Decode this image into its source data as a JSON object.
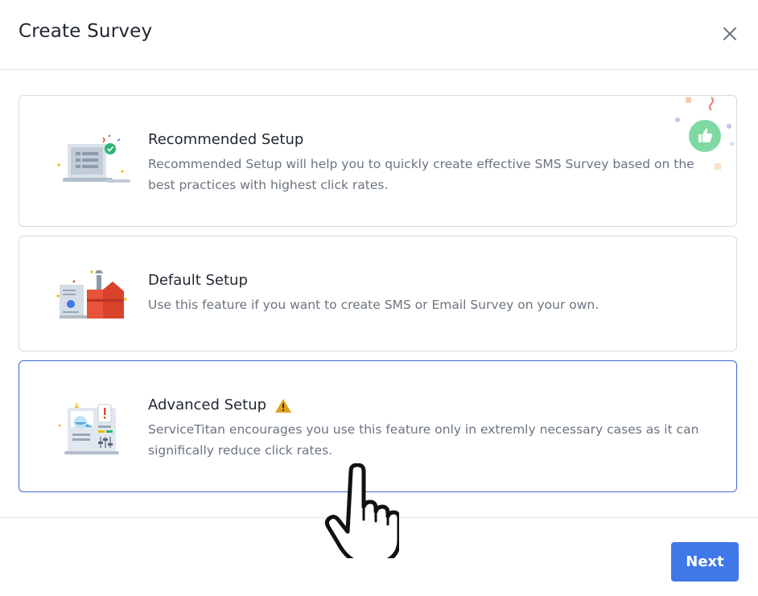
{
  "dialog": {
    "title": "Create Survey",
    "close_icon": "close-icon"
  },
  "options": [
    {
      "title": "Recommended Setup",
      "description": "Recommended Setup will help you to quickly create effective SMS Survey based on the best practices with highest click rates.",
      "illustration": "laptop-checklist-illustration",
      "badge_icon": "thumbs-up-icon"
    },
    {
      "title": "Default Setup",
      "description": "Use this feature if you want to create SMS or Email Survey on your own.",
      "illustration": "toolbox-illustration"
    },
    {
      "title": "Advanced Setup",
      "description": "ServiceTitan encourages you use this feature only in extremly necessary cases as it can significally reduce click rates.",
      "illustration": "control-panel-illustration",
      "warning_icon": "warning-icon",
      "selected": true
    }
  ],
  "footer": {
    "next_label": "Next"
  },
  "colors": {
    "accent": "#3f78e8",
    "selected_border": "#3d69d1",
    "warning": "#e0a21a",
    "thumbs_badge": "#7fd9a2"
  }
}
